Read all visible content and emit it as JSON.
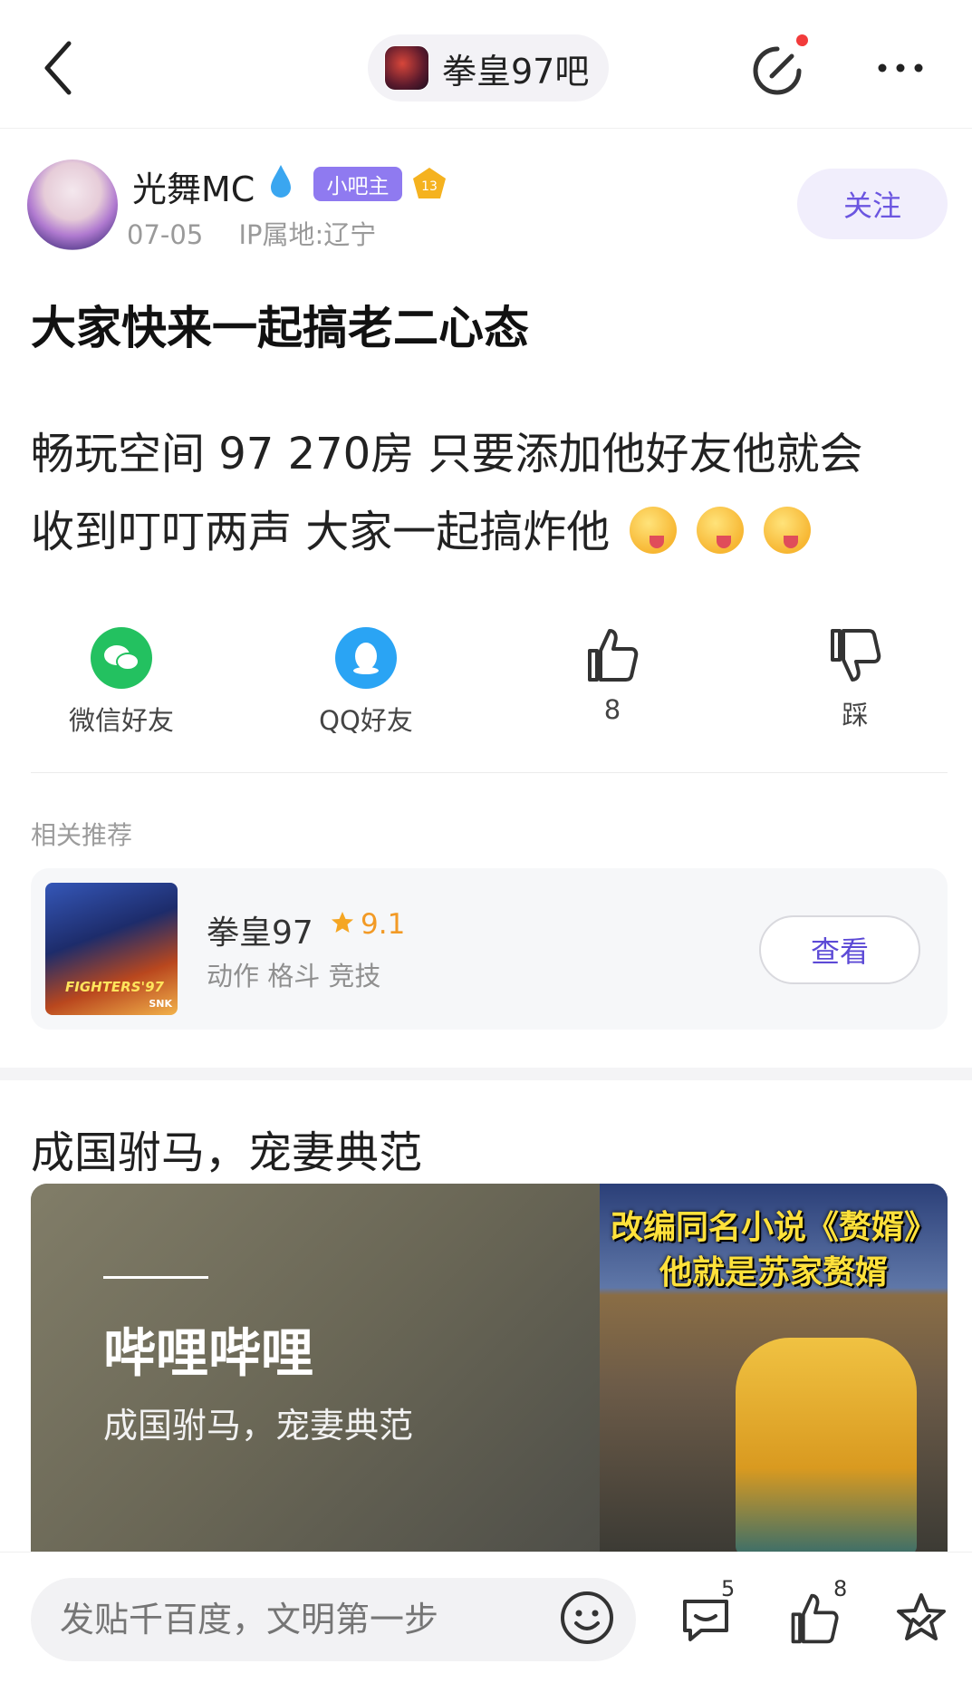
{
  "topbar": {
    "forum_name": "拳皇97吧",
    "icons": [
      "back-icon",
      "edit-icon",
      "more-icon"
    ],
    "notification_dot_color": "#f23b3b"
  },
  "author": {
    "name": "光舞MC",
    "role_badge": "小吧主",
    "level": "13",
    "date": "07-05",
    "ip_location": "IP属地:辽宁",
    "follow_label": "关注"
  },
  "post": {
    "title": "大家快来一起搞老二心态",
    "body_line1": "畅玩空间 97 270房 只要添加他好友他就会",
    "body_line2": "收到叮叮两声 大家一起搞炸他"
  },
  "actions": {
    "wechat_label": "微信好友",
    "qq_label": "QQ好友",
    "like_count": "8",
    "dislike_label": "踩",
    "colors": {
      "wechat": "#23c160",
      "qq": "#2aa4f4"
    }
  },
  "recommend": {
    "label": "相关推荐",
    "game_name": "拳皇97",
    "rating": "9.1",
    "tags": "动作 格斗 竞技",
    "view_label": "查看",
    "thumb_logo": "FIGHTERS'97",
    "thumb_brand": "SNK"
  },
  "ad": {
    "title": "成国驸马，宠妻典范",
    "brand": "哔哩哔哩",
    "subtitle": "成国驸马，宠妻典范",
    "caption_line1": "改编同名小说《赘婿》",
    "caption_line2": "他就是苏家赘婿"
  },
  "bottombar": {
    "input_placeholder": "发贴千百度，文明第一步",
    "comment_count": "5",
    "like_count": "8"
  },
  "accent_color": "#6b55e0"
}
